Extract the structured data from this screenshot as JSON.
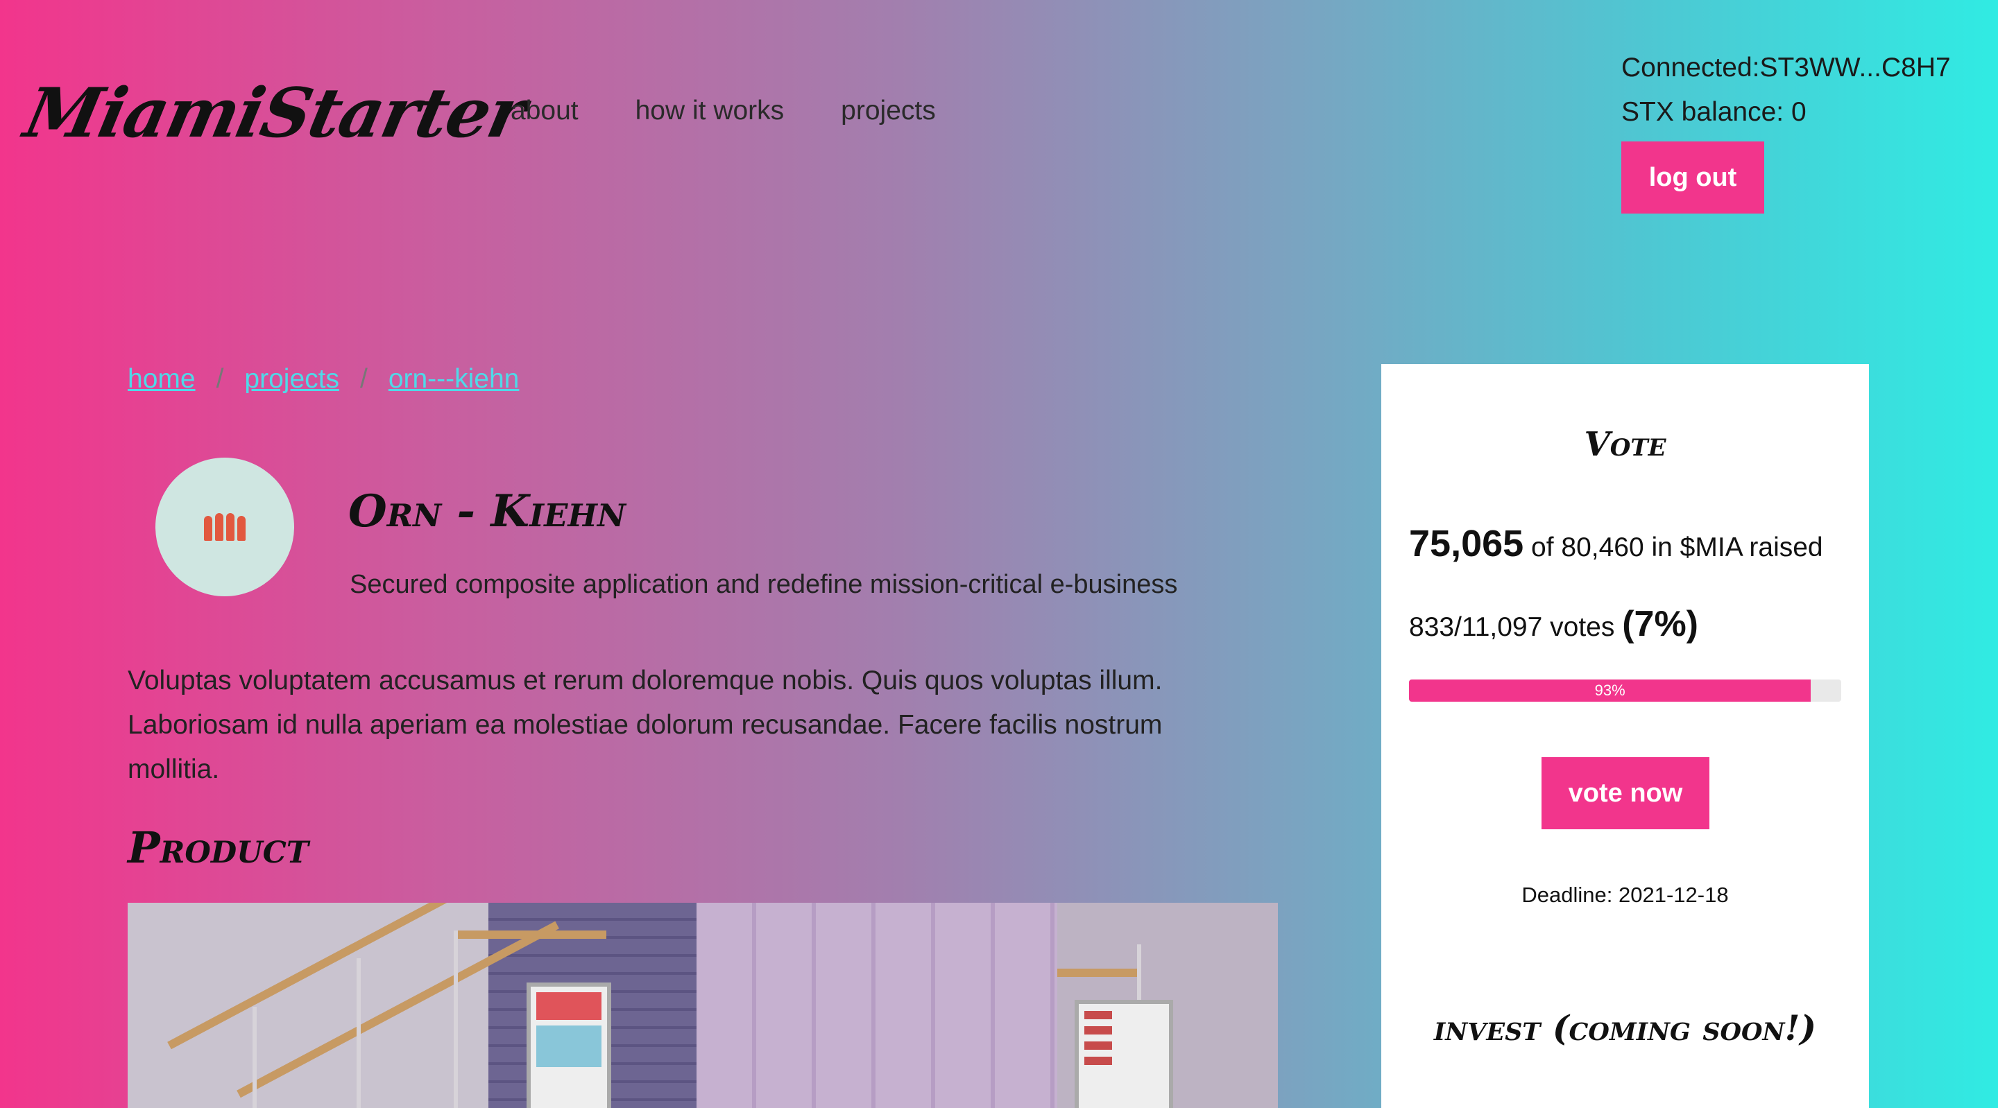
{
  "header": {
    "logo": "MiamiStarter",
    "nav": [
      "about",
      "how it works",
      "projects"
    ],
    "connected": "Connected:ST3WW...C8H7",
    "stx_balance": "STX balance: 0",
    "logout_label": "log out"
  },
  "breadcrumb": {
    "items": [
      "home",
      "projects",
      "orn---kiehn"
    ],
    "separator": "/"
  },
  "project": {
    "avatar_icon": "bowling-pins-icon",
    "title": "Orn - Kiehn",
    "subtitle": "Secured composite application and redefine mission-critical e-business",
    "description": "Voluptas voluptatem accusamus et rerum doloremque nobis. Quis quos voluptas illum. Laboriosam id nulla aperiam ea molestiae dolorum recusandae. Facere facilis nostrum mollitia.",
    "section_title": "Product"
  },
  "vote_panel": {
    "title": "Vote",
    "raised_amount": "75,065",
    "raised_text": "of 80,460 in $MIA raised",
    "votes_text": "833/11,097 votes",
    "votes_percent": "(7%)",
    "progress_label": "93%",
    "progress_value": 0.93,
    "vote_button": "vote now",
    "deadline": "Deadline: 2021-12-18",
    "invest_title": "invest (coming soon!)"
  },
  "colors": {
    "accent": "#f2358c",
    "link": "#4fd9e8",
    "gradient_start": "#f2358c",
    "gradient_end": "#30ebe3"
  }
}
